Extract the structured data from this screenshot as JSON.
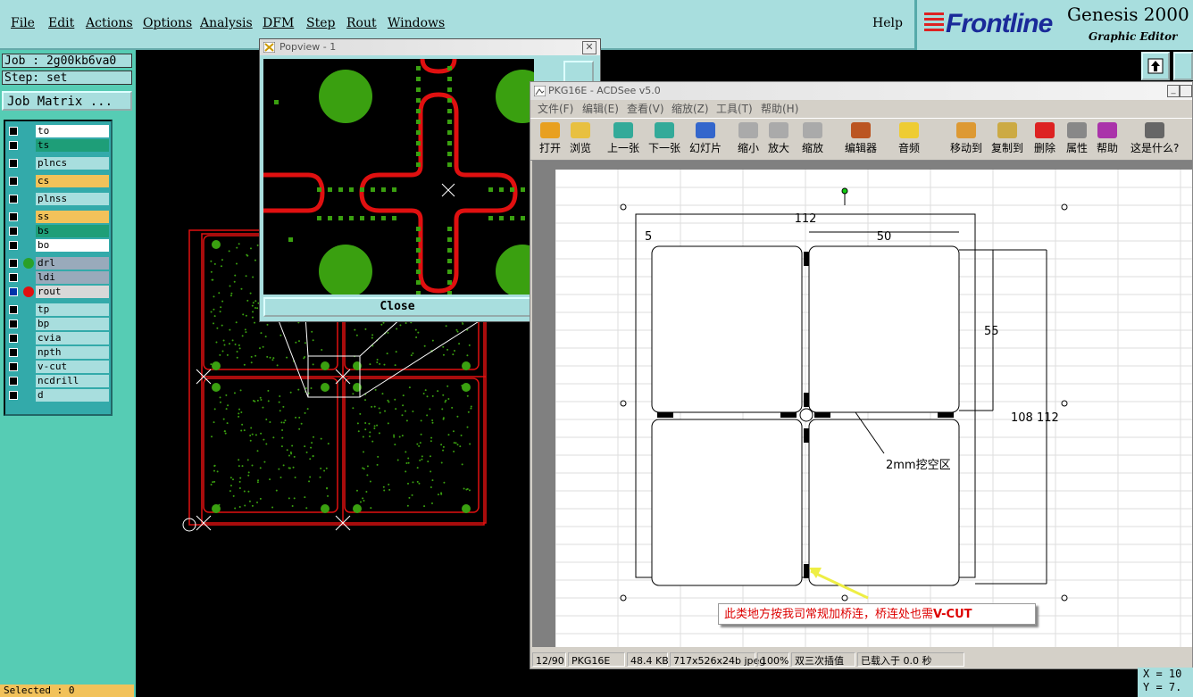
{
  "menubar": {
    "items": [
      "File",
      "Edit",
      "Actions",
      "Options",
      "Analysis",
      "DFM",
      "Step",
      "Rout",
      "Windows"
    ],
    "help": "Help"
  },
  "brand": {
    "logo": "Frontline",
    "product": "Genesis 2000",
    "subtitle": "Graphic Editor"
  },
  "job": {
    "job_label": "Job : 2g00kb6va0",
    "step_label": "Step: set",
    "matrix_button": "Job Matrix ..."
  },
  "layers": [
    {
      "name": "to",
      "bg": "#ffffff"
    },
    {
      "name": "ts",
      "bg": "#1e9e78"
    },
    {
      "name": "plncs",
      "bg": "#a8dede"
    },
    {
      "name": "cs",
      "bg": "#f2c25a"
    },
    {
      "name": "plnss",
      "bg": "#a8dede"
    },
    {
      "name": "ss",
      "bg": "#f2c25a"
    },
    {
      "name": "bs",
      "bg": "#1e9e78"
    },
    {
      "name": "bo",
      "bg": "#ffffff"
    },
    {
      "name": "drl",
      "bg": "#9ab",
      "dot": "#2aa02a"
    },
    {
      "name": "ldi",
      "bg": "#9ab"
    },
    {
      "name": "rout",
      "bg": "#d8d8d8",
      "dot": "#e01010",
      "active": true
    },
    {
      "name": "tp",
      "bg": "#a8dede"
    },
    {
      "name": "bp",
      "bg": "#a8dede"
    },
    {
      "name": "cvia",
      "bg": "#a8dede"
    },
    {
      "name": "npth",
      "bg": "#a8dede"
    },
    {
      "name": "v-cut",
      "bg": "#a8dede"
    },
    {
      "name": "ncdrill",
      "bg": "#a8dede"
    },
    {
      "name": "d",
      "bg": "#a8dede"
    }
  ],
  "status": {
    "selected": "Selected : 0",
    "x": "X = 10",
    "y": "Y = 7."
  },
  "popview": {
    "title": "Popview - 1",
    "close": "Close"
  },
  "acdsee": {
    "title": "PKG16E - ACDSee v5.0",
    "menu": [
      "文件(F)",
      "编辑(E)",
      "查看(V)",
      "缩放(Z)",
      "工具(T)",
      "帮助(H)"
    ],
    "tools": [
      "打开",
      "浏览",
      "上一张",
      "下一张",
      "幻灯片",
      "缩小",
      "放大",
      "缩放",
      "编辑器",
      "音频",
      "移动到",
      "复制到",
      "删除",
      "属性",
      "帮助",
      "这是什么?"
    ],
    "status": [
      "12/90",
      "PKG16E",
      "48.4 KB",
      "717x526x24b jpeg",
      "100%",
      "双三次插值",
      "已载入于 0.0 秒"
    ]
  },
  "drawing": {
    "dim_112": "112",
    "dim_5": "5",
    "dim_50": "50",
    "dim_55": "55",
    "dim_108_112": "108 112",
    "label_2mm": "2mm挖空区",
    "callout": "此类地方按我司常规加桥连，桥连处也需",
    "callout_bold": "V-CUT"
  },
  "colors": {
    "teal": "#a8dede",
    "panel": "#56ccb4",
    "pad_green": "#3aa010",
    "rout_red": "#e01010"
  }
}
